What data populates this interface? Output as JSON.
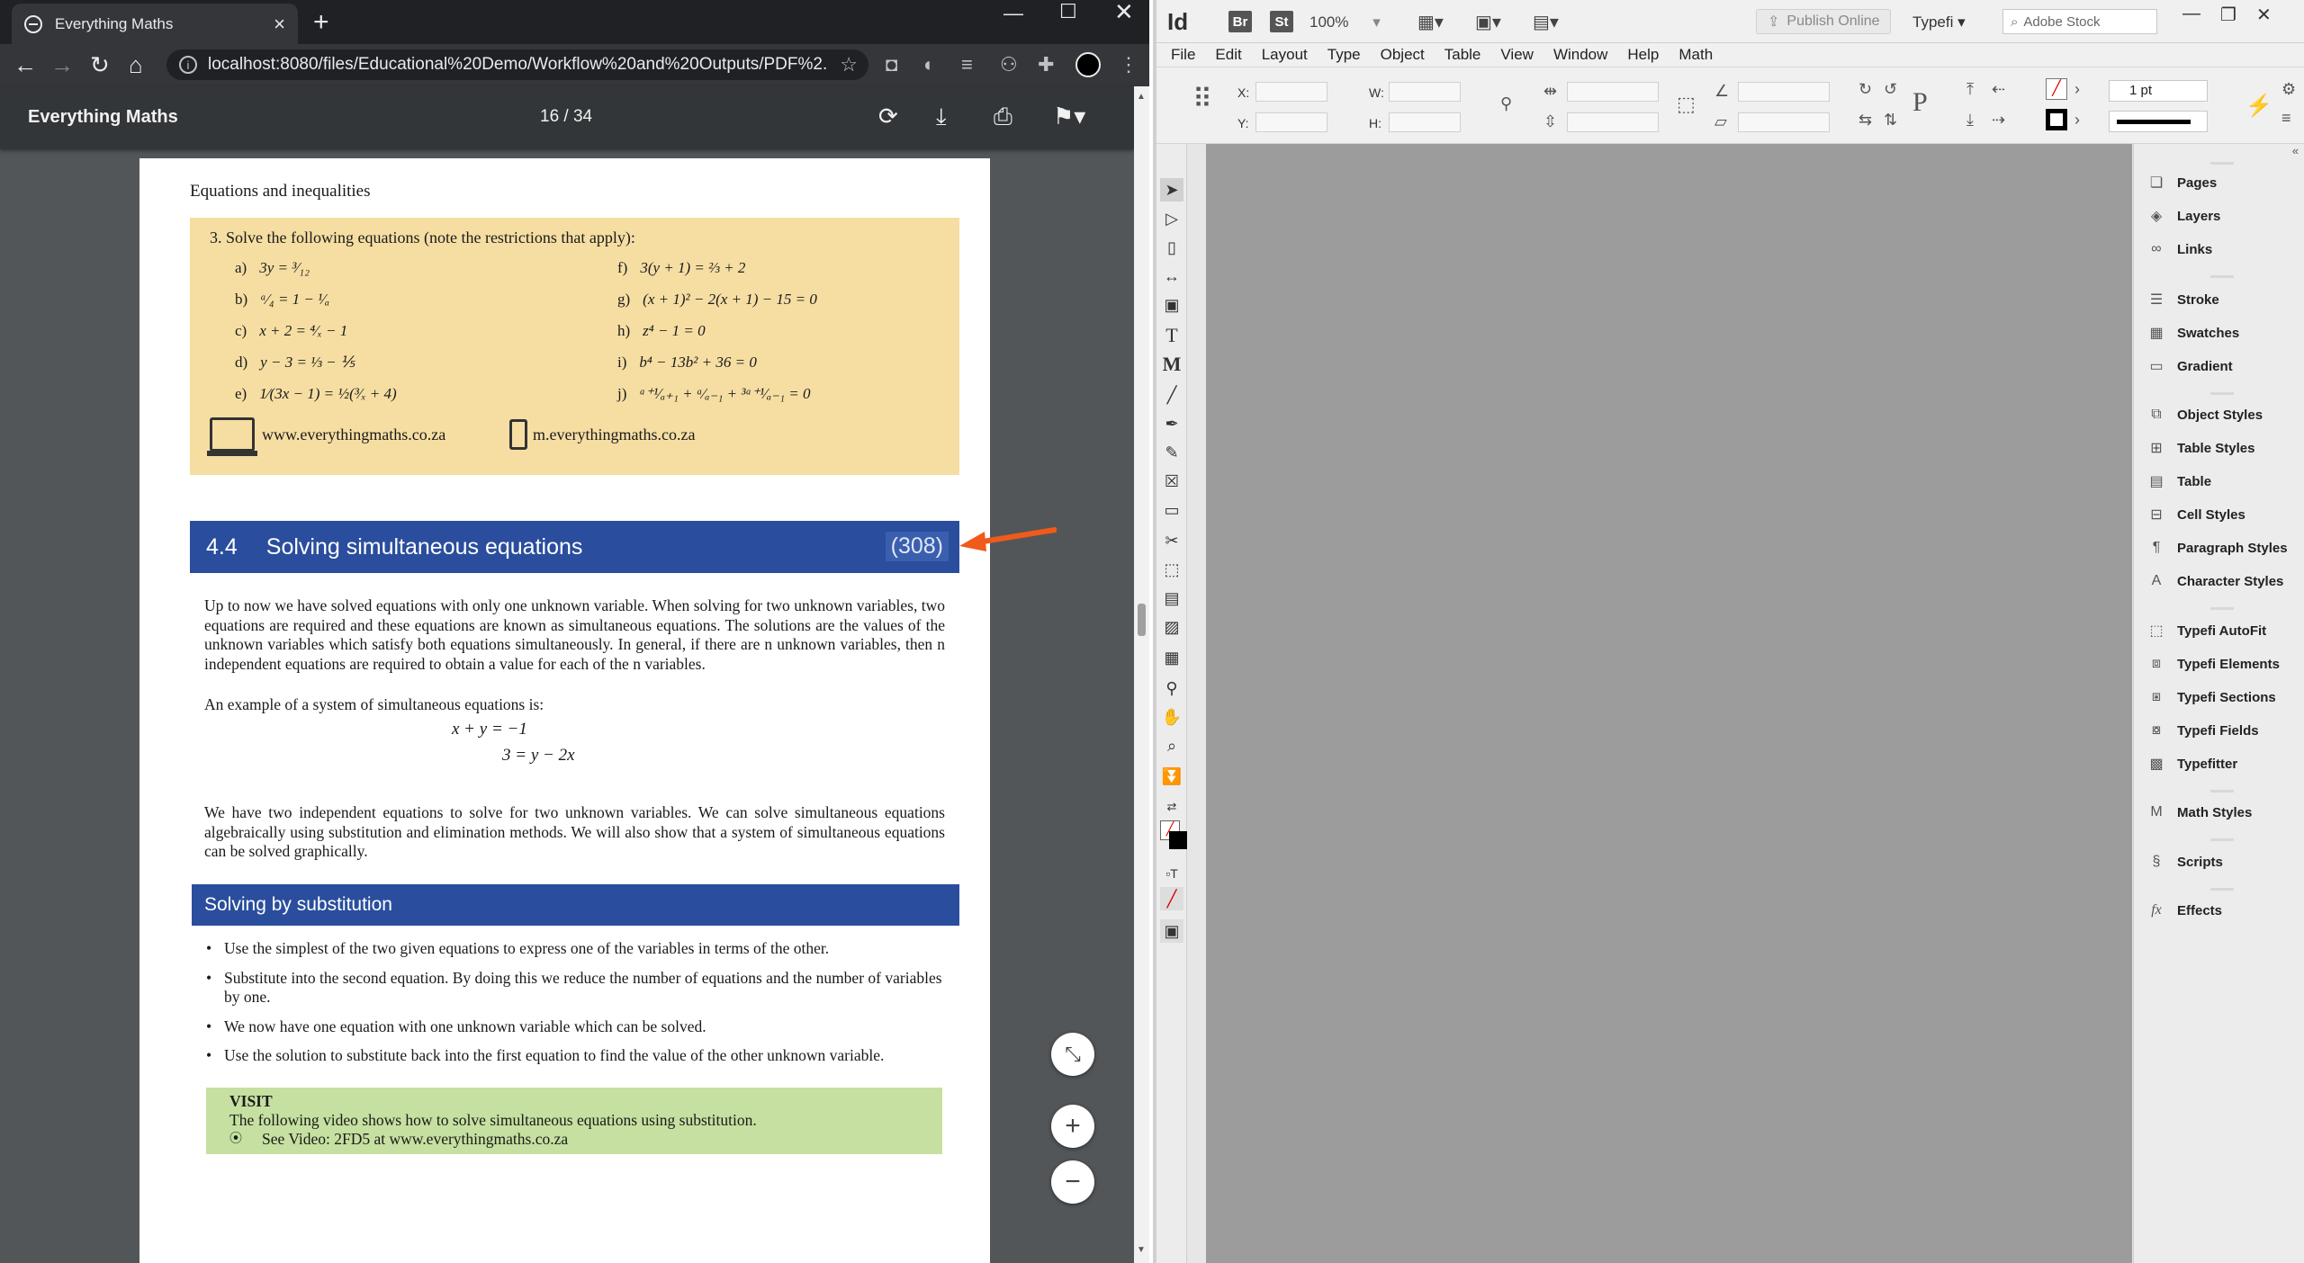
{
  "browser": {
    "tab_title": "Everything Maths",
    "url": "localhost:8080/files/Educational%20Demo/Workflow%20and%20Outputs/PDF%2..."
  },
  "pdf_viewer": {
    "title": "Everything Maths",
    "page_indicator": "16 / 34"
  },
  "pdf_page": {
    "running_head": "Equations and inequalities",
    "exercise_prompt": "3.  Solve the following equations (note the restrictions that apply):",
    "equations": [
      {
        "label": "a)",
        "expr": "3y = ³⁄₁₂"
      },
      {
        "label": "b)",
        "expr": "ᵃ⁄₄ = 1 − ¹⁄ₐ"
      },
      {
        "label": "c)",
        "expr": "x + 2 = ⁴⁄ₓ − 1"
      },
      {
        "label": "d)",
        "expr": "y − 3 = ⅓ − ⅕"
      },
      {
        "label": "e)",
        "expr": "1⁄(3x − 1) = ½(³⁄ₓ + 4)"
      },
      {
        "label": "f)",
        "expr": "3(y + 1) = ⅔ + 2"
      },
      {
        "label": "g)",
        "expr": "(x + 1)² − 2(x + 1) − 15 = 0"
      },
      {
        "label": "h)",
        "expr": "z⁴ − 1 = 0"
      },
      {
        "label": "i)",
        "expr": "b⁴ − 13b² + 36 = 0"
      },
      {
        "label": "j)",
        "expr": "ᵃ⁺¹⁄ₐ₊₁ + ᵃ⁄ₐ₋₁ + ³ᵃ⁺¹⁄ₐ₋₁ = 0"
      }
    ],
    "web_link": "www.everythingmaths.co.za",
    "mobile_link": "m.everythingmaths.co.za",
    "section_number": "4.4",
    "section_title": "Solving simultaneous equations",
    "section_ref": "(308)",
    "para1": "Up to now we have solved equations with only one unknown variable. When solving for two unknown variables, two equations are required and these equations are known as simultaneous equations. The solutions are the values of the unknown variables which satisfy both equations simultaneously. In general, if there are n unknown variables, then n independent equations are required to obtain a value for each of the n variables.",
    "para2": "An example of a system of simultaneous equations is:",
    "math1": "x  +  y = −1",
    "math2": "3 = y  −  2x",
    "para3": "We have two independent equations to solve for two unknown variables. We can solve simultaneous equations algebraically using substitution and elimination methods. We will also show that a system of simultaneous equations can be solved graphically.",
    "subsection_title": "Solving by substitution",
    "bullets": [
      "Use the simplest of the two given equations to express one of the variables in terms of the other.",
      "Substitute into the second equation. By doing this we reduce the number of equations and the number of variables by one.",
      "We now have one equation with one unknown variable which can be solved.",
      "Use the solution to substitute back into the first equation to find the value of the other unknown variable."
    ],
    "visit_head": "VISIT",
    "visit_line1": "The following video shows how to solve simultaneous equations using substitution.",
    "visit_line2": "See Video: 2FD5 at www.everythingmaths.co.za"
  },
  "indesign": {
    "logo": "Id",
    "chip_br": "Br",
    "chip_st": "St",
    "zoom": "100%",
    "publish_online": "Publish Online",
    "typefi_menu": "Typefi",
    "stock_placeholder": "Adobe Stock",
    "menu": [
      "File",
      "Edit",
      "Layout",
      "Type",
      "Object",
      "Table",
      "View",
      "Window",
      "Help",
      "Math"
    ],
    "control": {
      "x_label": "X:",
      "y_label": "Y:",
      "w_label": "W:",
      "h_label": "H:",
      "stroke_weight": "1 pt"
    },
    "panels": [
      "Pages",
      "Layers",
      "Links",
      "Stroke",
      "Swatches",
      "Gradient",
      "Object Styles",
      "Table Styles",
      "Table",
      "Cell Styles",
      "Paragraph Styles",
      "Character Styles",
      "Typefi AutoFit",
      "Typefi Elements",
      "Typefi Sections",
      "Typefi Fields",
      "Typefitter",
      "Math Styles",
      "Scripts",
      "Effects"
    ]
  },
  "colors": {
    "section_blue": "#2a4e9d",
    "exercise_yellow": "#f6dea3",
    "visit_green": "#c5e0a0",
    "annotation_arrow": "#f05a1a"
  }
}
